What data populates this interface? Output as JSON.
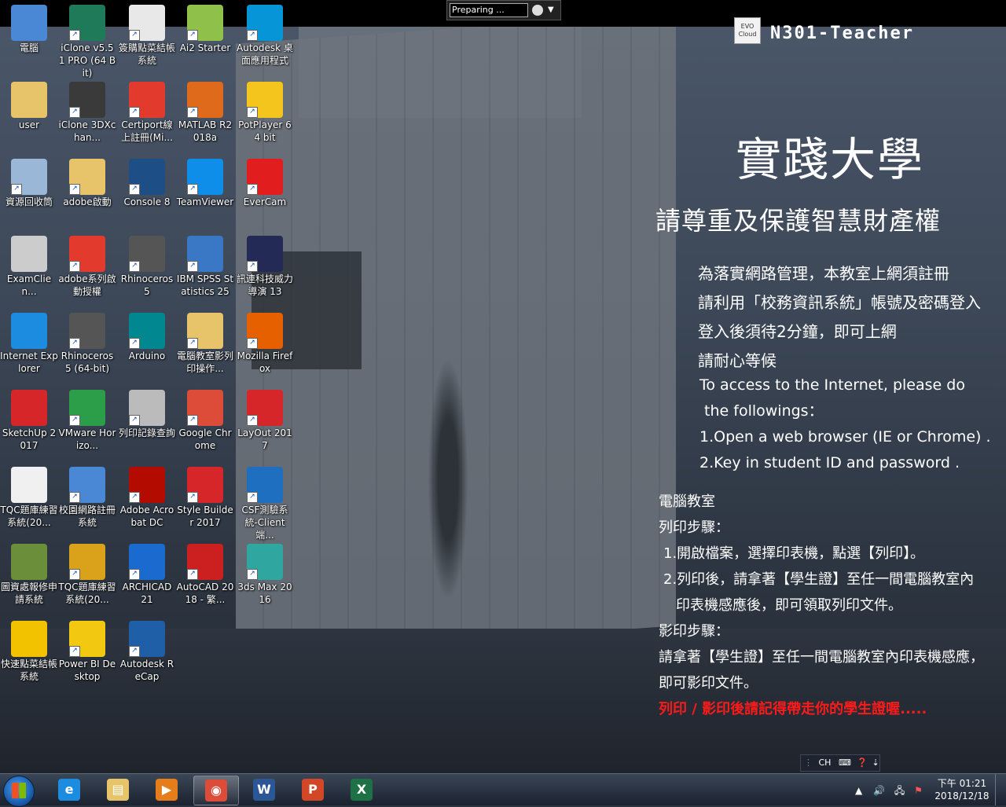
{
  "preparing": {
    "text": "Preparing ..."
  },
  "evo": {
    "text": "EVO Cloud"
  },
  "host": {
    "name": "N301-Teacher"
  },
  "desktop_icons": [
    {
      "label": "電腦",
      "icon": "computer-icon",
      "color": "#4a88d6"
    },
    {
      "label": "iClone v5.51 PRO (64 Bit)",
      "icon": "iclone-icon",
      "color": "#1f7a5a"
    },
    {
      "label": "簽購點菜結帳系統",
      "icon": "calculator-icon",
      "color": "#e8e8e8"
    },
    {
      "label": "Ai2 Starter",
      "icon": "android-icon",
      "color": "#8fc04a"
    },
    {
      "label": "Autodesk 桌面應用程式",
      "icon": "autodesk-icon",
      "color": "#0696d7"
    },
    {
      "label": "user",
      "icon": "user-folder-icon",
      "color": "#e7c46a"
    },
    {
      "label": "iClone 3DXchan...",
      "icon": "3dxchange-icon",
      "color": "#3a3a3a"
    },
    {
      "label": "Certiport線上註冊(Mi...",
      "icon": "pdf-icon",
      "color": "#e23b2e"
    },
    {
      "label": "MATLAB R2018a",
      "icon": "matlab-icon",
      "color": "#e06a1b"
    },
    {
      "label": "PotPlayer 64 bit",
      "icon": "potplayer-icon",
      "color": "#f4c51c"
    },
    {
      "label": "資源回收筒",
      "icon": "recycle-bin-icon",
      "color": "#9ab7d8"
    },
    {
      "label": "adobe啟動",
      "icon": "folder-icon",
      "color": "#e7c46a"
    },
    {
      "label": "Console 8",
      "icon": "console-icon",
      "color": "#1d4f86"
    },
    {
      "label": "TeamViewer",
      "icon": "teamviewer-icon",
      "color": "#0e8ee9"
    },
    {
      "label": "EverCam",
      "icon": "evercam-icon",
      "color": "#e11d1d"
    },
    {
      "label": "ExamClien...",
      "icon": "examclient-icon",
      "color": "#cccccc"
    },
    {
      "label": "adobe系列啟動授權",
      "icon": "pdf-icon",
      "color": "#e23b2e"
    },
    {
      "label": "Rhinoceros 5",
      "icon": "rhino-icon",
      "color": "#555555"
    },
    {
      "label": "IBM SPSS Statistics 25",
      "icon": "spss-icon",
      "color": "#3a78c6"
    },
    {
      "label": "訊連科技威力導演 13",
      "icon": "powerdirector-icon",
      "color": "#222a55"
    },
    {
      "label": "Internet Explorer",
      "icon": "ie-icon",
      "color": "#1c8ce0"
    },
    {
      "label": "Rhinoceros 5 (64-bit)",
      "icon": "rhino-icon",
      "color": "#555555"
    },
    {
      "label": "Arduino",
      "icon": "arduino-icon",
      "color": "#00878f"
    },
    {
      "label": "電腦教室影列印操作...",
      "icon": "folder-icon",
      "color": "#e7c46a"
    },
    {
      "label": "Mozilla Firefox",
      "icon": "firefox-icon",
      "color": "#e66000"
    },
    {
      "label": "SketchUp 2017",
      "icon": "sketchup-icon",
      "color": "#d6262a"
    },
    {
      "label": "VMware Horizo...",
      "icon": "vmware-icon",
      "color": "#2c9d48"
    },
    {
      "label": "列印記錄查詢",
      "icon": "printer-icon",
      "color": "#bbbbbb"
    },
    {
      "label": "Google Chrome",
      "icon": "chrome-icon",
      "color": "#dd4b39"
    },
    {
      "label": "LayOut 2017",
      "icon": "layout-icon",
      "color": "#d6262a"
    },
    {
      "label": "TQC題庫練習系統(20...",
      "icon": "tqc-icon",
      "color": "#f0f0f0"
    },
    {
      "label": "校園網路註冊系統",
      "icon": "network-icon",
      "color": "#4a88d6"
    },
    {
      "label": "Adobe Acrobat DC",
      "icon": "acrobat-icon",
      "color": "#b30b00"
    },
    {
      "label": "Style Builder 2017",
      "icon": "stylebuilder-icon",
      "color": "#d6262a"
    },
    {
      "label": "CSF測驗系統-Client端...",
      "icon": "csf-icon",
      "color": "#1f6fc0"
    },
    {
      "label": "圖資處報修申請系統",
      "icon": "users-icon",
      "color": "#6b8e3a"
    },
    {
      "label": "TQC題庫練習系統(20...",
      "icon": "tqc-icon",
      "color": "#d9a21a"
    },
    {
      "label": "ARCHICAD 21",
      "icon": "archicad-icon",
      "color": "#1b6ad0"
    },
    {
      "label": "AutoCAD 2018 - 繁...",
      "icon": "autocad-icon",
      "color": "#cc1f1f"
    },
    {
      "label": "3ds Max 2016",
      "icon": "3dsmax-icon",
      "color": "#2fa7a0"
    },
    {
      "label": "快速點菜結帳系統",
      "icon": "fork-knife-icon",
      "color": "#f2c200"
    },
    {
      "label": "Power BI Desktop",
      "icon": "powerbi-icon",
      "color": "#f2c811"
    },
    {
      "label": "Autodesk ReCap",
      "icon": "recap-icon",
      "color": "#1f5fa8"
    }
  ],
  "wallpaper": {
    "school": "實踐大學",
    "respect": "請尊重及保護智慧財產權",
    "notes": [
      "為落實網路管理，本教室上網須註冊",
      "請利用「校務資訊系統」帳號及密碼登入",
      "登入後須待2分鐘，即可上網",
      "請耐心等候"
    ],
    "notes_en": [
      "To access to the Internet, please do",
      " the followings：",
      "1.Open a web browser (IE or Chrome) .",
      "2.Key in student ID and password ."
    ],
    "lab_title": "電腦教室",
    "print_title": "列印步驟：",
    "print_steps": [
      "1.開啟檔案，選擇印表機，點選【列印】。",
      "2.列印後，請拿著【學生證】至任一間電腦教室內",
      "印表機感應後，即可領取列印文件。"
    ],
    "copy_title": "影印步驟：",
    "copy_steps": [
      "請拿著【學生證】至任一間電腦教室內印表機感應，",
      "即可影印文件。"
    ],
    "warning": "列印 / 影印後請記得帶走你的學生證喔....."
  },
  "language_bar": {
    "lang": "CH"
  },
  "taskbar": {
    "apps": [
      {
        "name": "internet-explorer",
        "glyph": "e",
        "color": "#1c8ce0",
        "pinned": false
      },
      {
        "name": "file-explorer",
        "glyph": "▤",
        "color": "#e7c46a",
        "pinned": false
      },
      {
        "name": "media-player",
        "glyph": "▶",
        "color": "#e47d1a",
        "pinned": false
      },
      {
        "name": "google-chrome",
        "glyph": "◉",
        "color": "#dd4b39",
        "pinned": true
      },
      {
        "name": "word",
        "glyph": "W",
        "color": "#2b5797",
        "pinned": false
      },
      {
        "name": "powerpoint",
        "glyph": "P",
        "color": "#d24726",
        "pinned": false
      },
      {
        "name": "excel",
        "glyph": "X",
        "color": "#1e7145",
        "pinned": false
      }
    ],
    "clock_time": "下午 01:21",
    "clock_date": "2018/12/18"
  }
}
